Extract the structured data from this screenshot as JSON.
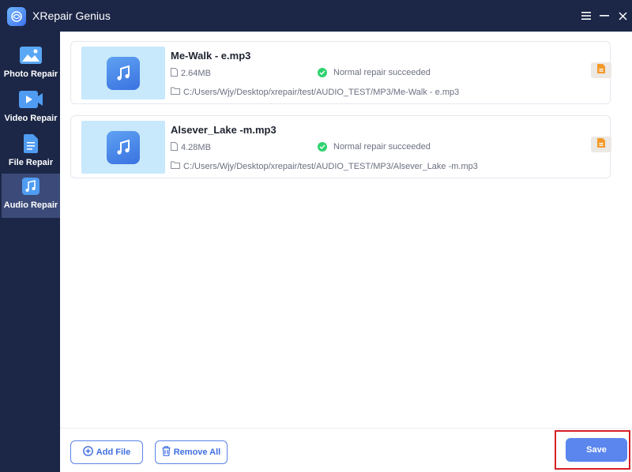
{
  "app": {
    "title": "XRepair Genius"
  },
  "sidebar": {
    "items": [
      {
        "label": "Photo Repair",
        "icon": "photo-icon",
        "active": false
      },
      {
        "label": "Video Repair",
        "icon": "video-icon",
        "active": false
      },
      {
        "label": "File Repair",
        "icon": "file-icon",
        "active": false
      },
      {
        "label": "Audio Repair",
        "icon": "music-icon",
        "active": true
      }
    ]
  },
  "files": [
    {
      "name": "Me-Walk - e.mp3",
      "size": "2.64MB",
      "status": "Normal repair succeeded",
      "path": "C:/Users/Wjy/Desktop/xrepair/test/AUDIO_TEST/MP3/Me-Walk - e.mp3"
    },
    {
      "name": "Alsever_Lake -m.mp3",
      "size": "4.28MB",
      "status": "Normal repair succeeded",
      "path": "C:/Users/Wjy/Desktop/xrepair/test/AUDIO_TEST/MP3/Alsever_Lake -m.mp3"
    }
  ],
  "footer": {
    "add_label": "Add File",
    "remove_label": "Remove All",
    "save_label": "Save"
  },
  "colors": {
    "sidebar_bg": "#1c2747",
    "accent": "#5a86ee",
    "success": "#2fd26f",
    "highlight": "#d61f26"
  }
}
